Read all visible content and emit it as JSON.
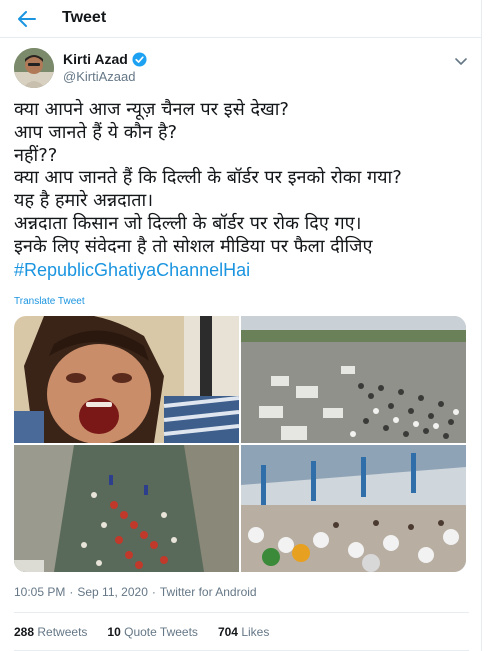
{
  "header": {
    "title": "Tweet"
  },
  "author": {
    "name": "Kirti Azad",
    "handle": "@KirtiAzaad"
  },
  "tweet": {
    "lines": [
      "क्या आपने आज न्यूज़ चैनल पर इसे देखा?",
      "आप जानते हैं ये कौन है?",
      "नहीं??",
      "क्या आप जानते हैं कि दिल्ली के बॉर्डर पर इनको रोका गया?",
      "यह है हमारे अन्नदाता।",
      "अन्नदाता किसान जो दिल्ली के बॉर्डर पर रोक दिए गए।",
      "इनके लिए संवेदना है तो सोशल मीडिया पर फैला दीजिए"
    ],
    "hashtag": "#RepublicGhatiyaChannelHai",
    "translate_label": "Translate Tweet"
  },
  "meta": {
    "time": "10:05 PM",
    "sep": "·",
    "date": "Sep 11, 2020",
    "source": "Twitter for Android"
  },
  "stats": [
    {
      "count": "288",
      "label": "Retweets"
    },
    {
      "count": "10",
      "label": "Quote Tweets"
    },
    {
      "count": "704",
      "label": "Likes"
    }
  ],
  "colors": {
    "accent": "#1b95e0",
    "text": "#14171a",
    "muted": "#657786",
    "border": "#e6ecf0"
  }
}
